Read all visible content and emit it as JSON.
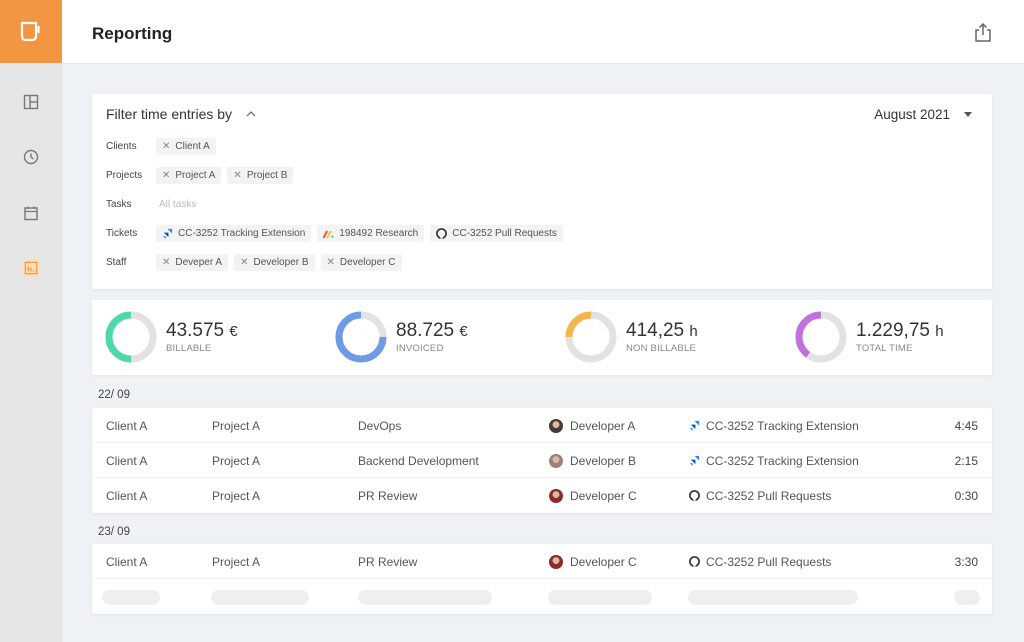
{
  "app": {
    "logo_icon": "mug-icon",
    "accent_color": "#f39641"
  },
  "sidebar": {
    "items": [
      {
        "name": "dashboard",
        "icon": "layout-grid-icon",
        "active": false
      },
      {
        "name": "time",
        "icon": "clock-icon",
        "active": false
      },
      {
        "name": "calendar",
        "icon": "calendar-icon",
        "active": false
      },
      {
        "name": "reporting",
        "icon": "bar-chart-icon",
        "active": true
      }
    ]
  },
  "header": {
    "title": "Reporting",
    "share_icon": "share-export-icon"
  },
  "filter": {
    "title": "Filter time entries by",
    "toggle_icon": "chevron-up-icon",
    "month": "August 2021",
    "rows": {
      "clients": {
        "label": "Clients",
        "chips": [
          "Client A"
        ]
      },
      "projects": {
        "label": "Projects",
        "chips": [
          "Project A",
          "Project B"
        ]
      },
      "tasks": {
        "label": "Tasks",
        "placeholder": "All tasks"
      },
      "tickets": {
        "label": "Tickets",
        "chips": [
          {
            "icon": "jira-icon",
            "text": "CC-3252 Tracking Extension"
          },
          {
            "icon": "monday-icon",
            "text": "198492  Research"
          },
          {
            "icon": "github-icon",
            "text": "CC-3252 Pull Requests"
          }
        ]
      },
      "staff": {
        "label": "Staff",
        "chips": [
          "Deveper A",
          "Developer B",
          "Developer C"
        ]
      }
    }
  },
  "stats": [
    {
      "value": "43.575",
      "unit": "€",
      "label": "BILLABLE",
      "fraction": 0.5,
      "color": "#4fd8a8"
    },
    {
      "value": "88.725",
      "unit": "€",
      "label": "INVOICED",
      "fraction": 0.75,
      "color": "#6f9be6"
    },
    {
      "value": "414,25",
      "unit": "h",
      "label": "NON BILLABLE",
      "fraction": 0.25,
      "color": "#f4b54c"
    },
    {
      "value": "1.229,75",
      "unit": "h",
      "label": "TOTAL TIME",
      "fraction": 0.4,
      "color": "#c071dc"
    }
  ],
  "entries": [
    {
      "date": "22/ 09",
      "rows": [
        {
          "client": "Client A",
          "project": "Project A",
          "task": "DevOps",
          "staff": "Developer A",
          "avatar_color": "#4a3a34",
          "ticket_icon": "jira-icon",
          "ticket": "CC-3252 Tracking Extension",
          "time": "4:45"
        },
        {
          "client": "Client A",
          "project": "Project A",
          "task": "Backend Development",
          "staff": "Developer B",
          "avatar_color": "#9a8276",
          "ticket_icon": "jira-icon",
          "ticket": "CC-3252 Tracking Extension",
          "time": "2:15"
        },
        {
          "client": "Client A",
          "project": "Project A",
          "task": "PR Review",
          "staff": "Developer C",
          "avatar_color": "#8e2a2a",
          "ticket_icon": "github-icon",
          "ticket": "CC-3252 Pull Requests",
          "time": "0:30"
        }
      ]
    },
    {
      "date": "23/ 09",
      "rows": [
        {
          "client": "Client A",
          "project": "Project A",
          "task": "PR Review",
          "staff": "Developer C",
          "avatar_color": "#8e2a2a",
          "ticket_icon": "github-icon",
          "ticket": "CC-3252 Pull Requests",
          "time": "3:30"
        }
      ],
      "loading_placeholder": true
    }
  ]
}
